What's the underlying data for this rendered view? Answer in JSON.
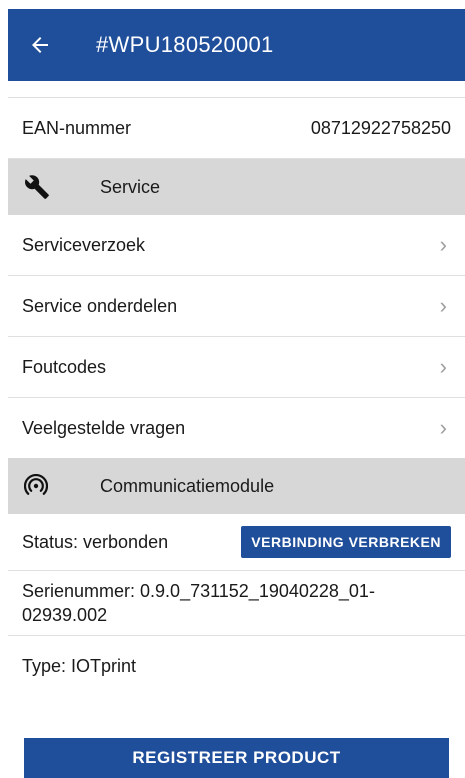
{
  "header": {
    "title": "#WPU180520001"
  },
  "details": {
    "ean_label": "EAN-nummer",
    "ean_value": "08712922758250"
  },
  "service": {
    "title": "Service",
    "items": [
      {
        "label": "Serviceverzoek"
      },
      {
        "label": "Service onderdelen"
      },
      {
        "label": "Foutcodes"
      },
      {
        "label": "Veelgestelde vragen"
      }
    ]
  },
  "comm": {
    "title": "Communicatiemodule",
    "status": "Status: verbonden",
    "disconnect_label": "VERBINDING VERBREKEN",
    "serial": "Serienummer: 0.9.0_731152_19040228_01-02939.002",
    "type": "Type: IOTprint"
  },
  "footer": {
    "register_label": "REGISTREER PRODUCT"
  },
  "colors": {
    "primary": "#1f4e9b",
    "section_bg": "#d7d7d7"
  },
  "icons": {
    "back": "arrow-left-icon",
    "service": "wrench-icon",
    "comm": "wireless-signal-icon",
    "chevron": "chevron-right-icon"
  }
}
